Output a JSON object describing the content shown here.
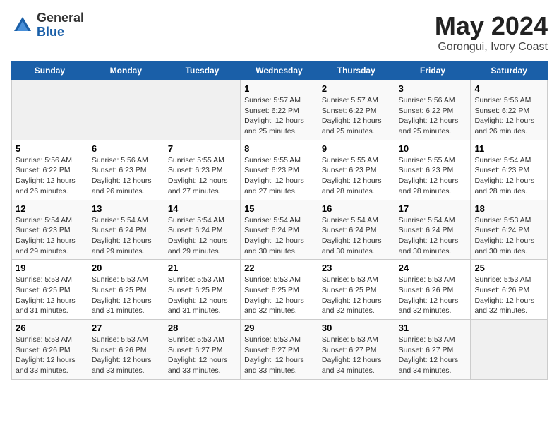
{
  "logo": {
    "general": "General",
    "blue": "Blue"
  },
  "title": "May 2024",
  "subtitle": "Gorongui, Ivory Coast",
  "days_of_week": [
    "Sunday",
    "Monday",
    "Tuesday",
    "Wednesday",
    "Thursday",
    "Friday",
    "Saturday"
  ],
  "weeks": [
    [
      {
        "day": "",
        "info": ""
      },
      {
        "day": "",
        "info": ""
      },
      {
        "day": "",
        "info": ""
      },
      {
        "day": "1",
        "info": "Sunrise: 5:57 AM\nSunset: 6:22 PM\nDaylight: 12 hours and 25 minutes."
      },
      {
        "day": "2",
        "info": "Sunrise: 5:57 AM\nSunset: 6:22 PM\nDaylight: 12 hours and 25 minutes."
      },
      {
        "day": "3",
        "info": "Sunrise: 5:56 AM\nSunset: 6:22 PM\nDaylight: 12 hours and 25 minutes."
      },
      {
        "day": "4",
        "info": "Sunrise: 5:56 AM\nSunset: 6:22 PM\nDaylight: 12 hours and 26 minutes."
      }
    ],
    [
      {
        "day": "5",
        "info": "Sunrise: 5:56 AM\nSunset: 6:22 PM\nDaylight: 12 hours and 26 minutes."
      },
      {
        "day": "6",
        "info": "Sunrise: 5:56 AM\nSunset: 6:23 PM\nDaylight: 12 hours and 26 minutes."
      },
      {
        "day": "7",
        "info": "Sunrise: 5:55 AM\nSunset: 6:23 PM\nDaylight: 12 hours and 27 minutes."
      },
      {
        "day": "8",
        "info": "Sunrise: 5:55 AM\nSunset: 6:23 PM\nDaylight: 12 hours and 27 minutes."
      },
      {
        "day": "9",
        "info": "Sunrise: 5:55 AM\nSunset: 6:23 PM\nDaylight: 12 hours and 28 minutes."
      },
      {
        "day": "10",
        "info": "Sunrise: 5:55 AM\nSunset: 6:23 PM\nDaylight: 12 hours and 28 minutes."
      },
      {
        "day": "11",
        "info": "Sunrise: 5:54 AM\nSunset: 6:23 PM\nDaylight: 12 hours and 28 minutes."
      }
    ],
    [
      {
        "day": "12",
        "info": "Sunrise: 5:54 AM\nSunset: 6:23 PM\nDaylight: 12 hours and 29 minutes."
      },
      {
        "day": "13",
        "info": "Sunrise: 5:54 AM\nSunset: 6:24 PM\nDaylight: 12 hours and 29 minutes."
      },
      {
        "day": "14",
        "info": "Sunrise: 5:54 AM\nSunset: 6:24 PM\nDaylight: 12 hours and 29 minutes."
      },
      {
        "day": "15",
        "info": "Sunrise: 5:54 AM\nSunset: 6:24 PM\nDaylight: 12 hours and 30 minutes."
      },
      {
        "day": "16",
        "info": "Sunrise: 5:54 AM\nSunset: 6:24 PM\nDaylight: 12 hours and 30 minutes."
      },
      {
        "day": "17",
        "info": "Sunrise: 5:54 AM\nSunset: 6:24 PM\nDaylight: 12 hours and 30 minutes."
      },
      {
        "day": "18",
        "info": "Sunrise: 5:53 AM\nSunset: 6:24 PM\nDaylight: 12 hours and 30 minutes."
      }
    ],
    [
      {
        "day": "19",
        "info": "Sunrise: 5:53 AM\nSunset: 6:25 PM\nDaylight: 12 hours and 31 minutes."
      },
      {
        "day": "20",
        "info": "Sunrise: 5:53 AM\nSunset: 6:25 PM\nDaylight: 12 hours and 31 minutes."
      },
      {
        "day": "21",
        "info": "Sunrise: 5:53 AM\nSunset: 6:25 PM\nDaylight: 12 hours and 31 minutes."
      },
      {
        "day": "22",
        "info": "Sunrise: 5:53 AM\nSunset: 6:25 PM\nDaylight: 12 hours and 32 minutes."
      },
      {
        "day": "23",
        "info": "Sunrise: 5:53 AM\nSunset: 6:25 PM\nDaylight: 12 hours and 32 minutes."
      },
      {
        "day": "24",
        "info": "Sunrise: 5:53 AM\nSunset: 6:26 PM\nDaylight: 12 hours and 32 minutes."
      },
      {
        "day": "25",
        "info": "Sunrise: 5:53 AM\nSunset: 6:26 PM\nDaylight: 12 hours and 32 minutes."
      }
    ],
    [
      {
        "day": "26",
        "info": "Sunrise: 5:53 AM\nSunset: 6:26 PM\nDaylight: 12 hours and 33 minutes."
      },
      {
        "day": "27",
        "info": "Sunrise: 5:53 AM\nSunset: 6:26 PM\nDaylight: 12 hours and 33 minutes."
      },
      {
        "day": "28",
        "info": "Sunrise: 5:53 AM\nSunset: 6:27 PM\nDaylight: 12 hours and 33 minutes."
      },
      {
        "day": "29",
        "info": "Sunrise: 5:53 AM\nSunset: 6:27 PM\nDaylight: 12 hours and 33 minutes."
      },
      {
        "day": "30",
        "info": "Sunrise: 5:53 AM\nSunset: 6:27 PM\nDaylight: 12 hours and 34 minutes."
      },
      {
        "day": "31",
        "info": "Sunrise: 5:53 AM\nSunset: 6:27 PM\nDaylight: 12 hours and 34 minutes."
      },
      {
        "day": "",
        "info": ""
      }
    ]
  ]
}
